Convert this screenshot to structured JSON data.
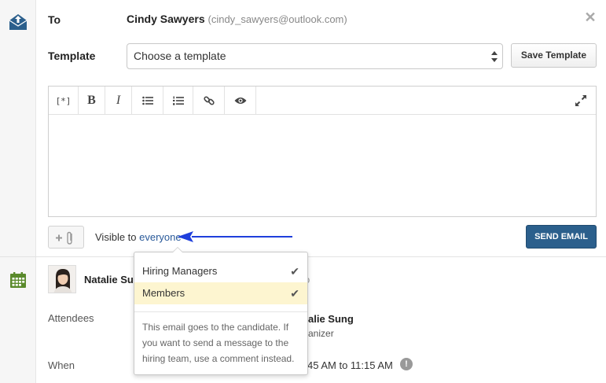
{
  "header": {
    "to_label": "To",
    "recipient_name": "Cindy Sawyers",
    "recipient_email": "(cindy_sawyers@outlook.com)",
    "close_glyph": "✕"
  },
  "template": {
    "label": "Template",
    "select_value": "Choose a template",
    "save_button": "Save Template"
  },
  "editor": {
    "toolbar": [
      {
        "name": "placeholder-tag-icon",
        "glyph": "[*]"
      },
      {
        "name": "bold-icon",
        "glyph": "B"
      },
      {
        "name": "italic-icon",
        "glyph": "I"
      },
      {
        "name": "bullet-list-icon",
        "glyph": ""
      },
      {
        "name": "numbered-list-icon",
        "glyph": ""
      },
      {
        "name": "link-icon",
        "glyph": ""
      },
      {
        "name": "preview-eye-icon",
        "glyph": ""
      },
      {
        "name": "expand-icon",
        "glyph": ""
      }
    ],
    "body_text": ""
  },
  "footer": {
    "visible_prefix": "Visible to",
    "visible_link": "everyone",
    "send_button": "SEND EMAIL"
  },
  "dropdown": {
    "items": [
      {
        "label": "Hiring Managers",
        "checked": true,
        "selected": false
      },
      {
        "label": "Members",
        "checked": true,
        "selected": true
      }
    ],
    "check_glyph": "✔",
    "note": "This email goes to the candidate. If you want to send a message to the hiring team, use a comment instead."
  },
  "event": {
    "organizer_partial": "Natalie Su",
    "organizer_tail": "o",
    "attendees_label": "Attendees",
    "attendee_name_partial": "alie Sung",
    "attendee_role_partial": "anizer",
    "when_label": "When",
    "when_value_partial": "45 AM to 11:15 AM",
    "warn_glyph": "!"
  },
  "colors": {
    "accent": "#2b5f8c",
    "link": "#2a5a9a",
    "selected_row": "#fdf5d0",
    "annotation_arrow": "#1f3fdc",
    "calendar_green": "#5a8a2c"
  }
}
